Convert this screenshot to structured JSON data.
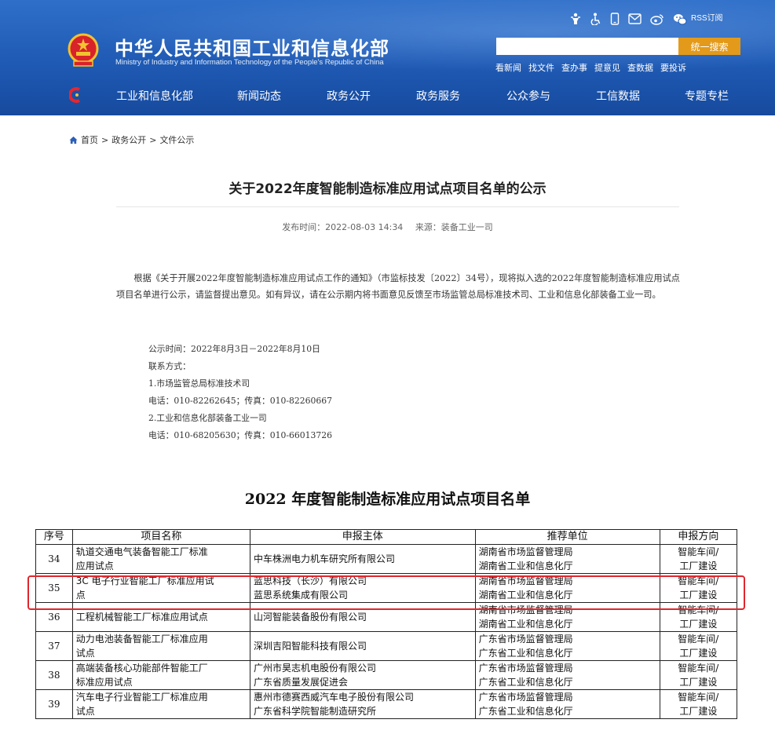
{
  "header": {
    "site_title": "中华人民共和国工业和信息化部",
    "site_subtitle": "Ministry of Industry and Information Technology of the People's Republic of China",
    "rss_label": "RSS订阅",
    "top_icons": [
      "elderly-mode-icon",
      "accessibility-icon",
      "mobile-icon",
      "mail-icon",
      "weibo-icon",
      "weixin-icon"
    ],
    "search": {
      "placeholder": "",
      "button_label": "统一搜索"
    },
    "quick_links": [
      "看新闻",
      "找文件",
      "查办事",
      "提意见",
      "查数据",
      "要投诉"
    ],
    "nav": [
      "工业和信息化部",
      "新闻动态",
      "政务公开",
      "政务服务",
      "公众参与",
      "工信数据",
      "专题专栏"
    ],
    "colors": {
      "bar": "#1f5ab4",
      "search_button": "#e39a1b"
    }
  },
  "breadcrumb": [
    "首页",
    "政务公开",
    "文件公示"
  ],
  "article": {
    "title": "关于2022年度智能制造标准应用试点项目名单的公示",
    "publish_time_label": "发布时间：2022-08-03 14:34",
    "source_label": "来源：装备工业一司",
    "paragraph": "根据《关于开展2022年度智能制造标准应用试点工作的通知》（市监标技发〔2022〕34号），现将拟入选的2022年度智能制造标准应用试点项目名单进行公示，请监督提出意见。如有异议，请在公示期内将书面意见反馈至市场监管总局标准技术司、工业和信息化部装备工业一司。",
    "info_lines": [
      "公示时间：2022年8月3日－2022年8月10日",
      "联系方式：",
      "1.市场监管总局标准技术司",
      "电话：010-82262645；传真：010-82260667",
      "2.工业和信息化部装备工业一司",
      "电话：010-68205630；传真：010-66013726"
    ]
  },
  "table": {
    "title": "2022 年度智能制造标准应用试点项目名单",
    "headers": [
      "序号",
      "项目名称",
      "申报主体",
      "推荐单位",
      "申报方向"
    ],
    "rows": [
      {
        "no": "34",
        "name": [
          "轨道交通电气装备智能工厂标准",
          "应用试点"
        ],
        "entity": [
          "中车株洲电力机车研究所有限公司"
        ],
        "recommender": [
          "湖南省市场监督管理局",
          "湖南省工业和信息化厅"
        ],
        "direction": [
          "智能车间/",
          "工厂建设"
        ]
      },
      {
        "no": "35",
        "name": [
          "3C 电子行业智能工厂标准应用试",
          "点"
        ],
        "entity": [
          "蓝思科技（长沙）有限公司",
          "蓝思系统集成有限公司"
        ],
        "recommender": [
          "湖南省市场监督管理局",
          "湖南省工业和信息化厅"
        ],
        "direction": [
          "智能车间/",
          "工厂建设"
        ]
      },
      {
        "no": "36",
        "name": [
          "工程机械智能工厂标准应用试点"
        ],
        "entity": [
          "山河智能装备股份有限公司"
        ],
        "recommender": [
          "湖南省市场监督管理局",
          "湖南省工业和信息化厅"
        ],
        "direction": [
          "智能车间/",
          "工厂建设"
        ]
      },
      {
        "no": "37",
        "name": [
          "动力电池装备智能工厂标准应用",
          "试点"
        ],
        "entity": [
          "深圳吉阳智能科技有限公司"
        ],
        "recommender": [
          "广东省市场监督管理局",
          "广东省工业和信息化厅"
        ],
        "direction": [
          "智能车间/",
          "工厂建设"
        ]
      },
      {
        "no": "38",
        "name": [
          "高端装备核心功能部件智能工厂",
          "标准应用试点"
        ],
        "entity": [
          "广州市昊志机电股份有限公司",
          "广东省质量发展促进会"
        ],
        "recommender": [
          "广东省市场监督管理局",
          "广东省工业和信息化厅"
        ],
        "direction": [
          "智能车间/",
          "工厂建设"
        ]
      },
      {
        "no": "39",
        "name": [
          "汽车电子行业智能工厂标准应用",
          "试点"
        ],
        "entity": [
          "惠州市德赛西威汽车电子股份有限公司",
          "广东省科学院智能制造研究所"
        ],
        "recommender": [
          "广东省市场监督管理局",
          "广东省工业和信息化厅"
        ],
        "direction": [
          "智能车间/",
          "工厂建设"
        ]
      }
    ]
  }
}
